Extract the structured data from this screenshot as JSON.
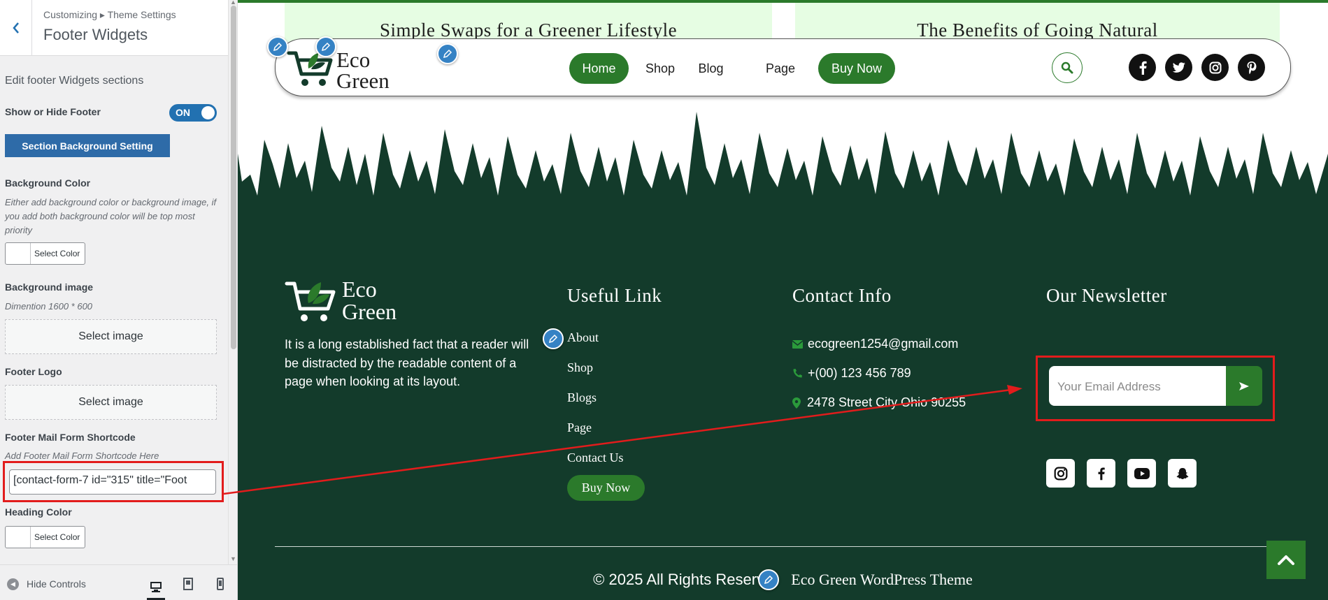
{
  "customizer": {
    "breadcrumb": "Customizing ▸ Theme Settings",
    "title": "Footer Widgets",
    "description": "Edit footer Widgets sections",
    "show_hide_label": "Show or Hide Footer",
    "toggle_state": "ON",
    "section_bg_button": "Section Background Setting",
    "bg_color_label": "Background Color",
    "bg_color_note": "Either add background color or background image, if you add both background color will be top most priority",
    "select_color": "Select Color",
    "bg_image_label": "Background image",
    "bg_image_note": "Dimention 1600 * 600",
    "select_image": "Select image",
    "footer_logo_label": "Footer Logo",
    "mail_form_label": "Footer Mail Form Shortcode",
    "mail_form_note": "Add Footer Mail Form Shortcode Here",
    "mail_form_value": "[contact-form-7 id=\"315\" title=\"Foot",
    "heading_color_label": "Heading Color",
    "hide_controls": "Hide Controls",
    "devices": [
      "desktop-icon",
      "tablet-icon",
      "mobile-icon"
    ]
  },
  "posts": [
    {
      "title": "Simple Swaps for a Greener Lifestyle"
    },
    {
      "title": "The Benefits of Going Natural"
    }
  ],
  "header": {
    "logo_line1": "Eco",
    "logo_line2": "Green",
    "nav": [
      "Home",
      "Shop",
      "Blog",
      "Page",
      "Buy Now"
    ],
    "social": [
      "facebook-icon",
      "twitter-icon",
      "instagram-icon",
      "pinterest-icon"
    ]
  },
  "footer": {
    "logo_line1": "Eco",
    "logo_line2": "Green",
    "about": "It is a long established fact that a reader will be distracted by the readable content of a page when looking at its layout.",
    "useful_heading": "Useful Link",
    "links": [
      "About",
      "Shop",
      "Blogs",
      "Page",
      "Contact Us"
    ],
    "buy_now": "Buy Now",
    "contact_heading": "Contact Info",
    "email": "ecogreen1254@gmail.com",
    "phone": "+(00) 123 456 789",
    "address": "2478 Street City Ohio 90255",
    "newsletter_heading": "Our Newsletter",
    "email_placeholder": "Your Email Address",
    "social": [
      "instagram-icon",
      "facebook-icon",
      "youtube-icon",
      "snapchat-icon"
    ],
    "copyright_a": "© 2025 All Rights Reserve",
    "copyright_b": "Eco Green WordPress Theme"
  },
  "colors": {
    "brand_green": "#2b7a2b",
    "footer_bg": "#133b2b",
    "highlight": "#e21c1c",
    "wp_blue": "#2271b1"
  }
}
